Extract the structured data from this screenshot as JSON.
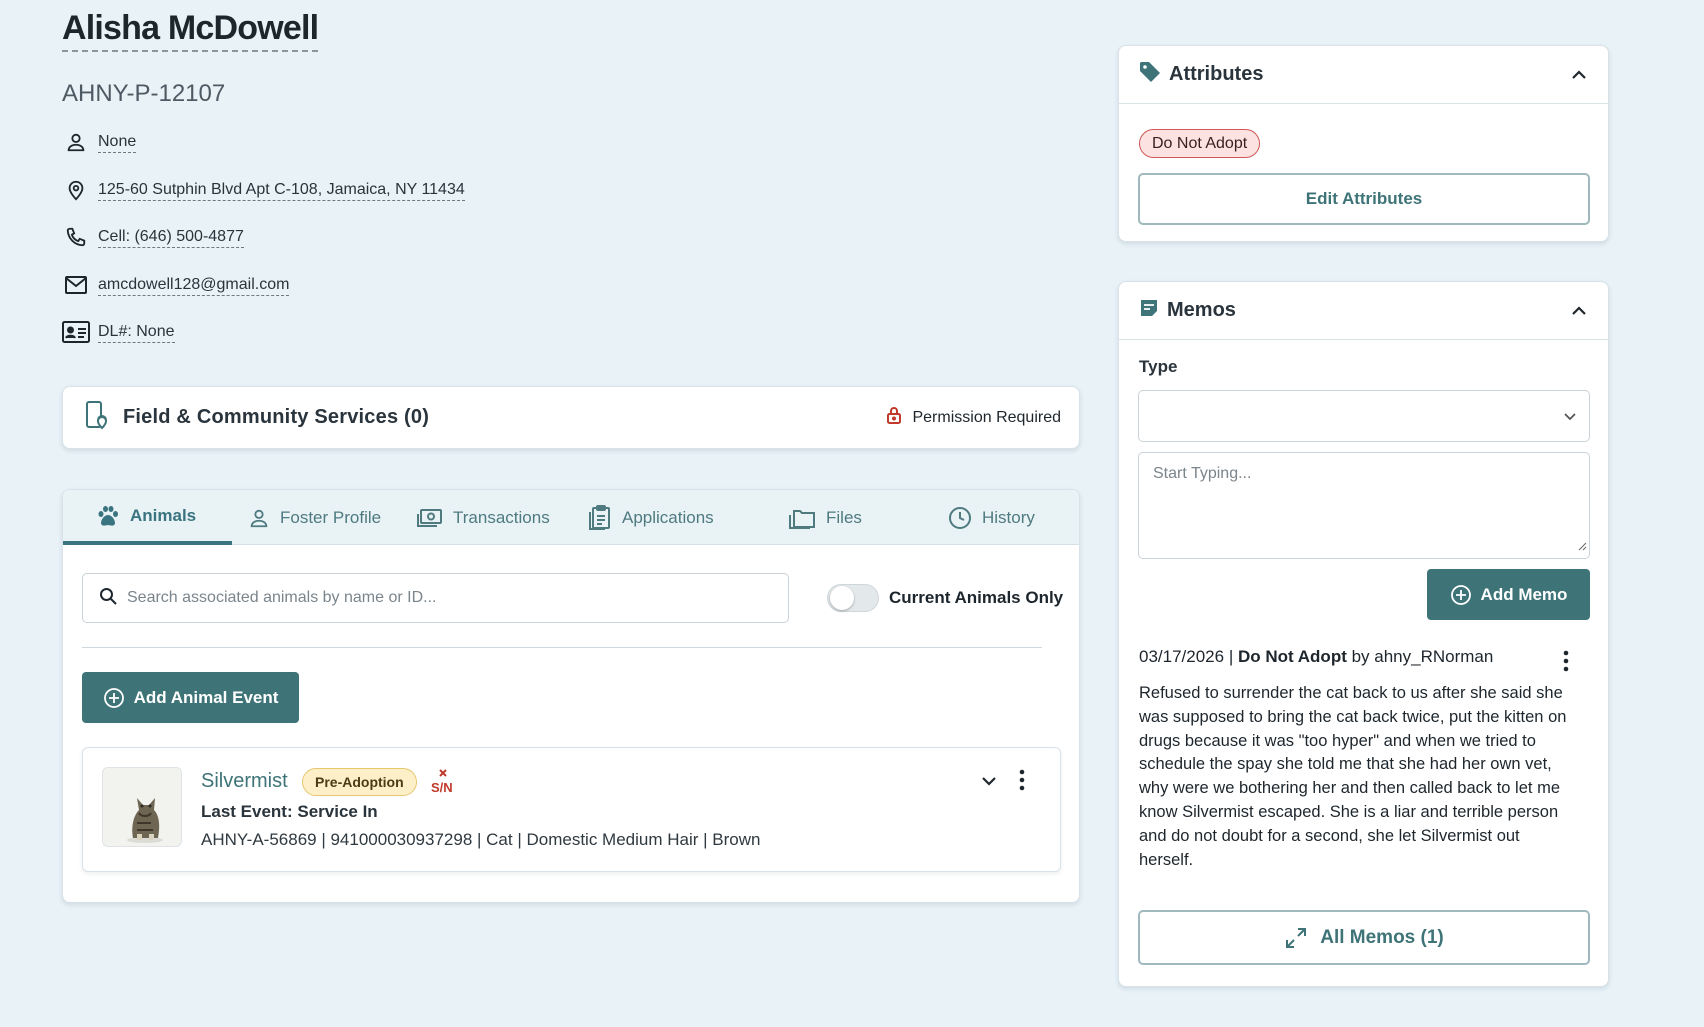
{
  "person": {
    "name": "Alisha McDowell",
    "id": "AHNY-P-12107",
    "contact_person": "None",
    "address": "125-60 Sutphin Blvd Apt C-108, Jamaica, NY 11434",
    "phone": "Cell: (646) 500-4877",
    "email": "amcdowell128@gmail.com",
    "dl": "DL#: None"
  },
  "field_services": {
    "title": "Field & Community Services (0)",
    "permission": "Permission Required"
  },
  "tabs": [
    {
      "label": "Animals",
      "icon": "paw-icon",
      "active": true
    },
    {
      "label": "Foster Profile",
      "icon": "person-icon",
      "active": false
    },
    {
      "label": "Transactions",
      "icon": "money-icon",
      "active": false
    },
    {
      "label": "Applications",
      "icon": "clipboard-icon",
      "active": false
    },
    {
      "label": "Files",
      "icon": "folder-icon",
      "active": false
    },
    {
      "label": "History",
      "icon": "clock-icon",
      "active": false
    }
  ],
  "animals_panel": {
    "search_placeholder": "Search associated animals by name or ID...",
    "toggle_label": "Current Animals Only",
    "add_event_label": "Add Animal Event",
    "animal": {
      "name": "Silvermist",
      "status_badge": "Pre-Adoption",
      "sn_label": "S/N",
      "last_event": "Last Event: Service In",
      "meta": "AHNY-A-56869 | 941000030937298 | Cat | Domestic Medium Hair | Brown"
    }
  },
  "attributes": {
    "title": "Attributes",
    "tag": "Do Not Adopt",
    "edit_label": "Edit Attributes"
  },
  "memos": {
    "title": "Memos",
    "type_label": "Type",
    "type_value": "",
    "text_placeholder": "Start Typing...",
    "add_label": "Add Memo",
    "entry": {
      "date": "03/17/2026",
      "type": "Do Not Adopt",
      "by": "by ahny_RNorman",
      "body": "Refused to surrender the cat back to us after she said she was supposed to bring the cat back twice, put the kitten on drugs because it was \"too hyper\" and when we tried to schedule the spay she told me that she had her own vet, why were we bothering her and then called back to let me know Silvermist escaped. She is a liar and terrible person and do not doubt for a second, she let Silvermist out herself."
    },
    "all_label": "All Memos (1)"
  },
  "colors": {
    "accent": "#3e7478",
    "background": "#e8f2f7",
    "danger": "#d15858",
    "warning_badge": "#fdf0c9"
  }
}
